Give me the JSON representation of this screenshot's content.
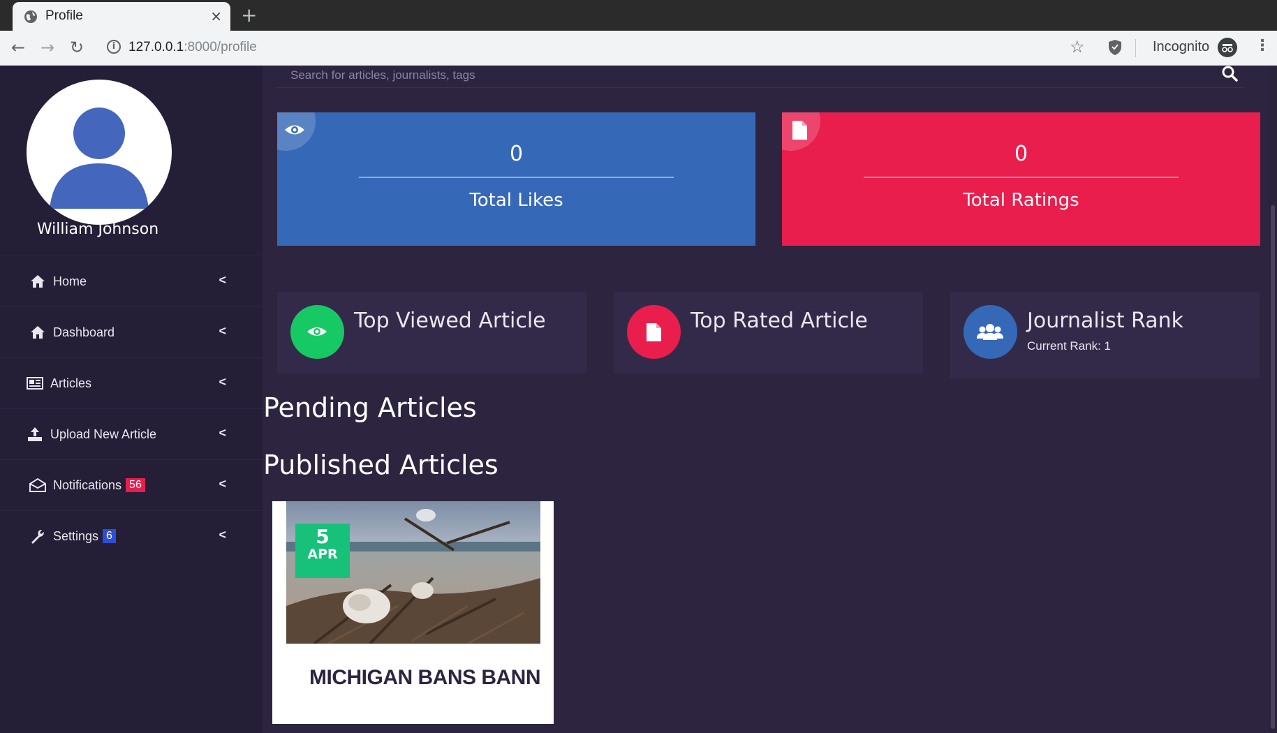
{
  "browser": {
    "tab_title": "Profile",
    "tab_close": "×",
    "new_tab": "+",
    "url_host": "127.0.0.1",
    "url_path": ":8000/profile",
    "incognito_label": "Incognito"
  },
  "sidebar": {
    "user_name": "William Johnson",
    "items": [
      {
        "label": "Home",
        "icon": "home-icon"
      },
      {
        "label": "Dashboard",
        "icon": "home-icon"
      },
      {
        "label": "Articles",
        "icon": "newspaper-icon"
      },
      {
        "label": "Upload New Article",
        "icon": "upload-icon"
      },
      {
        "label": "Notifications",
        "icon": "envelope-open-icon",
        "badge": "56"
      },
      {
        "label": "Settings",
        "icon": "wrench-icon",
        "badge": "6"
      }
    ]
  },
  "search": {
    "placeholder": "Search for articles, journalists, tags"
  },
  "stats": {
    "likes": {
      "value": "0",
      "label": "Total Likes",
      "color": "#3668b8"
    },
    "ratings": {
      "value": "0",
      "label": "Total Ratings",
      "color": "#e91e4d"
    }
  },
  "info_cards": {
    "top_viewed": {
      "title": "Top Viewed Article",
      "color": "#17c964"
    },
    "top_rated": {
      "title": "Top Rated Article",
      "color": "#e91e4d"
    },
    "rank": {
      "title": "Journalist Rank",
      "subtitle": "Current Rank: 1",
      "color": "#3668b8"
    }
  },
  "sections": {
    "pending": "Pending Articles",
    "published": "Published Articles"
  },
  "article": {
    "day": "5",
    "month": "APR",
    "title": "MICHIGAN BANS BANNING PLASTIC BAGS"
  }
}
